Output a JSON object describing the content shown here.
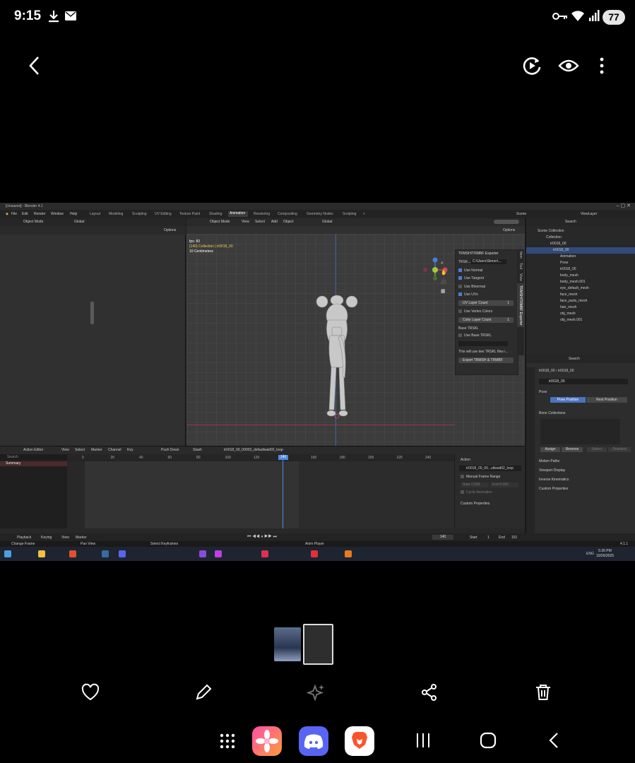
{
  "status_bar": {
    "time": "9:15",
    "battery": "77"
  },
  "blender": {
    "window_title": "[Unsaved] - Blender 4.1",
    "menus": [
      "File",
      "Edit",
      "Render",
      "Window",
      "Help"
    ],
    "workspaces": [
      "Layout",
      "Modeling",
      "Sculpting",
      "UV Editing",
      "Texture Paint",
      "Shading",
      "Animation",
      "Rendering",
      "Compositing",
      "Geometry Nodes",
      "Scripting"
    ],
    "active_workspace": "Animation",
    "scene": "Scene",
    "view_layer": "ViewLayer",
    "left_panel": {
      "mode": "Object Mode",
      "options": "Options",
      "orientation": "Global"
    },
    "viewport": {
      "mode": "Object Mode",
      "menus": [
        "View",
        "Select",
        "Add",
        "Object"
      ],
      "orientation": "Global",
      "options": "Options",
      "fps": "fps: 60",
      "collection_line": "(140) Collection | tr0018_00",
      "scale": "10 Centimeters"
    },
    "exporter": {
      "title": "TRMSH/TRMBF Exporter",
      "path_label": "TRSK...",
      "path_value": "C:\\Users\\Simon\\...",
      "use_normal": "Use Normal",
      "use_tangent": "Use Tangent",
      "use_binormal": "Use Binormal",
      "use_uvs": "Use UVs",
      "uv_layer_count": "UV Layer Count",
      "uv_layer_value": "1",
      "use_vertex_colors": "Use Vertex Colors",
      "color_layer_count": "Color Layer Count",
      "color_layer_value": "1",
      "base_trskl": "Base TRSKL",
      "use_base_trskl": "Use Base TRSKL",
      "note": "This will use two TRSKL files i...",
      "export_button": "Export TRMSH & TRMBF",
      "side_tabs": [
        "Item",
        "Tool",
        "View",
        "TRMSH/TRMBF Exporter"
      ]
    },
    "outliner": {
      "search": "Search",
      "rows": [
        "Scene Collection",
        "Collection",
        "tr0018_00",
        "Animation",
        "Pose",
        "tr0018_00",
        "body_mesh",
        "body_mesh.001",
        "eye_default_mesh",
        "face_mesh",
        "face_parts_mesh",
        "hair_mesh",
        "obj_mesh",
        "obj_mesh.001"
      ]
    },
    "properties": {
      "search": "Search",
      "breadcrumb_a": "tr0018_00",
      "breadcrumb_b": "tr0018_00",
      "object_name": "tr0018_00",
      "pose": "Pose",
      "pose_position": "Pose Position",
      "rest_position": "Rest Position",
      "bone_collections": "Bone Collections",
      "assign": "Assign",
      "remove": "Remove",
      "select": "Select",
      "deselect": "Deselect",
      "sections": [
        "Motion Paths",
        "Viewport Display",
        "Inverse Kinematics",
        "Custom Properties"
      ]
    },
    "action_editor": {
      "editor": "Action Editor",
      "menus": [
        "View",
        "Select",
        "Marker",
        "Channel",
        "Key"
      ],
      "push_down": "Push Down",
      "stash": "Stash",
      "action_name": "tr0018_00_00003_defaultwait02_loop",
      "search": "Search",
      "summary": "Summary",
      "ticks": [
        "0",
        "20",
        "40",
        "60",
        "80",
        "100",
        "120",
        "140",
        "160",
        "180",
        "200",
        "220",
        "240"
      ],
      "current_frame": "140",
      "side": {
        "action": "Action",
        "action_field": "tr0018_00_00...ultwait02_loop",
        "manual_frame_range": "Manual Frame Range",
        "start": "Start",
        "start_val": "0.000",
        "end": "End",
        "end_val": "0.000",
        "cyclic": "Cyclic Animation",
        "custom_props": "Custom Properties"
      }
    },
    "playback": {
      "menus": [
        "Playback",
        "Keying",
        "View",
        "Marker"
      ],
      "frame": "140",
      "start_label": "Start",
      "start_val": "1",
      "end_label": "End",
      "end_val": "151"
    },
    "status": {
      "change_frame": "Change Frame",
      "pan_view": "Pan View",
      "select_keyframes": "Select Keyframes",
      "anim_player": "Anim Player",
      "version": "4.1.1"
    },
    "taskbar": {
      "lang": "ENG",
      "time": "5:26 PM",
      "date": "10/26/2025"
    }
  },
  "nav_apps": [
    "app-drawer",
    "blossom-app",
    "discord-app",
    "brave-browser"
  ]
}
